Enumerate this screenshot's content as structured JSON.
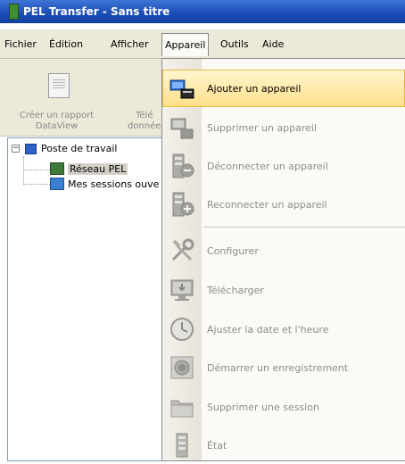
{
  "window": {
    "title": "PEL Transfer - Sans titre"
  },
  "menubar": {
    "items": [
      {
        "label": "Fichier"
      },
      {
        "label": "Édition"
      },
      {
        "label": "Afficher"
      },
      {
        "label": "Appareil",
        "open": true
      },
      {
        "label": "Outils"
      },
      {
        "label": "Aide"
      }
    ]
  },
  "toolbar": {
    "report_button": {
      "line1": "Créer un rapport",
      "line2": "DataView",
      "icon": "report-icon"
    },
    "download_button": {
      "line1": "Télé",
      "line2": "donnée",
      "icon": "download-icon"
    }
  },
  "tree": {
    "root": {
      "label": "Poste de travail",
      "icon": "computer-icon",
      "expander": "−"
    },
    "children": [
      {
        "label": "Réseau PEL",
        "icon": "network-icon",
        "selected": true
      },
      {
        "label": "Mes sessions ouve",
        "icon": "sessions-icon"
      }
    ]
  },
  "appareil_menu": {
    "items": [
      {
        "label": "Ajouter un appareil",
        "icon": "add-device-icon",
        "enabled": true,
        "highlighted": true
      },
      {
        "label": "Supprimer un appareil",
        "icon": "remove-device-icon",
        "enabled": false
      },
      {
        "label": "Déconnecter un appareil",
        "icon": "disconnect-device-icon",
        "enabled": false
      },
      {
        "label": "Reconnecter un appareil",
        "icon": "reconnect-device-icon",
        "enabled": false
      },
      {
        "label": "Configurer",
        "icon": "configure-tools-icon",
        "enabled": false
      },
      {
        "label": "Télécharger",
        "icon": "download-monitor-icon",
        "enabled": false
      },
      {
        "label": "Ajuster la date et l'heure",
        "icon": "clock-icon",
        "enabled": false
      },
      {
        "label": "Démarrer un enregistrement",
        "icon": "record-icon",
        "enabled": false
      },
      {
        "label": "Supprimer une session",
        "icon": "folder-icon",
        "enabled": false
      },
      {
        "label": "État",
        "icon": "status-icon",
        "enabled": false
      }
    ]
  },
  "colors": {
    "title_bar": "#1c4db8",
    "highlight": "#ffe08a",
    "disabled_text": "#8c8c8c"
  }
}
